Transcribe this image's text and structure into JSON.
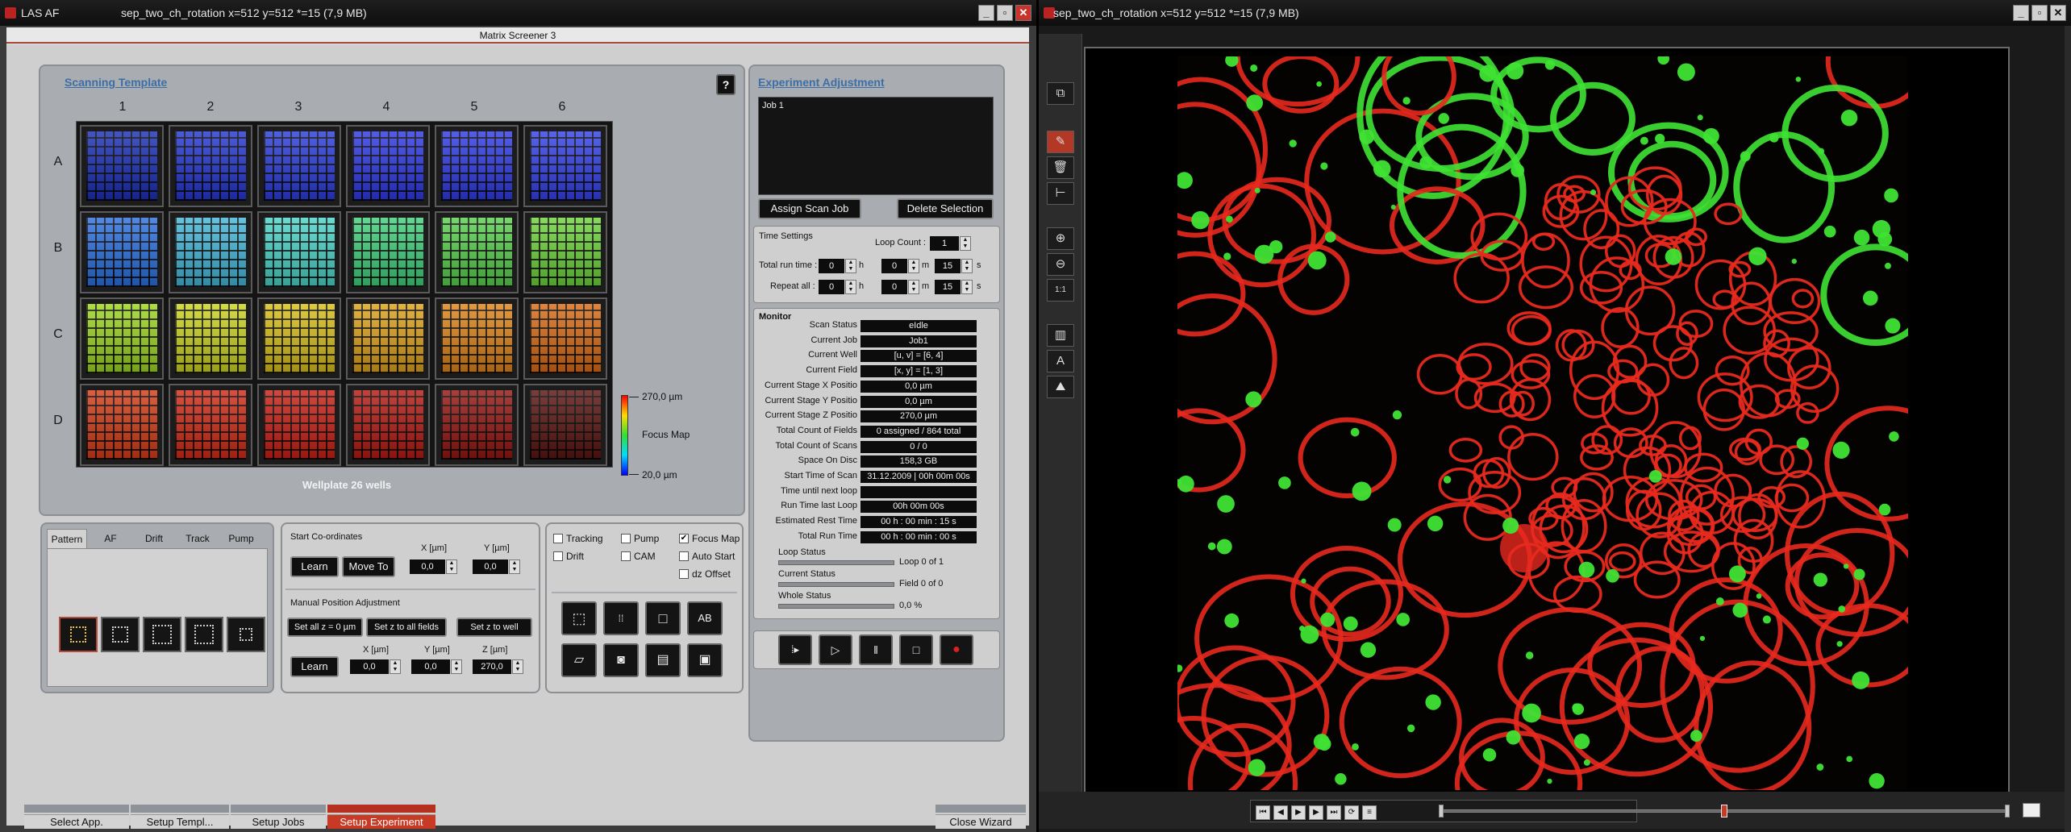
{
  "left_window": {
    "title": "LAS AF",
    "subtitle": "sep_two_ch_rotation x=512 y=512 *=15 (7,9 MB)",
    "app_title": "Matrix Screener 3"
  },
  "right_window": {
    "title": "sep_two_ch_rotation x=512 y=512 *=15 (7,9 MB)"
  },
  "window_buttons": {
    "minimize": "_",
    "restore": "▫",
    "close": "✕"
  },
  "scanning_template": {
    "title": "Scanning Template",
    "help": "?",
    "columns": [
      "1",
      "2",
      "3",
      "4",
      "5",
      "6"
    ],
    "rows": [
      "A",
      "B",
      "C",
      "D"
    ],
    "well_colors": [
      [
        "#1a2fb8",
        "#2436d2",
        "#2a3cdc",
        "#2d38e6",
        "#2f3ae6",
        "#3341ea"
      ],
      [
        "#2b6fe0",
        "#43b6d8",
        "#4ad4c8",
        "#3fd07a",
        "#58cf4d",
        "#6dd23b"
      ],
      [
        "#9cd520",
        "#cbd31f",
        "#d8be1a",
        "#dca11a",
        "#dd8318",
        "#d86a15"
      ],
      [
        "#d43b17",
        "#d12a16",
        "#c91f14",
        "#b51912",
        "#951511",
        "#5a1410"
      ]
    ],
    "plate_label": "Wellplate 26 wells",
    "colorbar": {
      "max": "270,0 µm",
      "label": "Focus Map",
      "min": "20,0 µm"
    }
  },
  "pattern_panel": {
    "tabs": [
      "Pattern",
      "AF",
      "Drift",
      "Track",
      "Pump"
    ]
  },
  "start_coords": {
    "title": "Start Co-ordinates",
    "x_label": "X [µm]",
    "y_label": "Y [µm]",
    "learn": "Learn",
    "move_to": "Move To",
    "x_value": "0,0",
    "y_value": "0,0"
  },
  "manual_pos": {
    "title": "Manual Position Adjustment",
    "set_all": "Set all  z = 0 µm",
    "set_fields": "Set z to all fields",
    "set_well": "Set z to well",
    "learn": "Learn",
    "x_label": "X [µm]",
    "y_label": "Y [µm]",
    "z_label": "Z [µm]",
    "x_value": "0,0",
    "y_value": "0,0",
    "z_value": "270,0"
  },
  "options": {
    "tracking": "Tracking",
    "pump": "Pump",
    "focus_map": "Focus Map",
    "drift": "Drift",
    "cam": "CAM",
    "auto_start": "Auto Start",
    "dz_offset": "dz Offset"
  },
  "experiment": {
    "title": "Experiment Adjustment",
    "job": "Job 1",
    "assign": "Assign Scan Job",
    "delete": "Delete Selection"
  },
  "time_settings": {
    "title": "Time Settings",
    "loop_count_label": "Loop Count :",
    "loop_count": "1",
    "total_label": "Total run time :",
    "repeat_label": "Repeat all :",
    "total_h": "0",
    "total_m": "0",
    "total_s": "15",
    "repeat_h": "0",
    "repeat_m": "0",
    "repeat_s": "15",
    "h": "h",
    "m": "m",
    "s": "s"
  },
  "monitor": {
    "title": "Monitor",
    "rows": [
      {
        "label": "Scan Status",
        "value": "eIdle"
      },
      {
        "label": "Current Job",
        "value": "Job1"
      },
      {
        "label": "Current Well",
        "value": "[u, v] = [6, 4]"
      },
      {
        "label": "Current Field",
        "value": "[x, y] = [1, 3]"
      },
      {
        "label": "Current Stage X Positio",
        "value": "0,0 µm"
      },
      {
        "label": "Current Stage Y Positio",
        "value": "0,0 µm"
      },
      {
        "label": "Current Stage Z Positio",
        "value": "270,0 µm"
      },
      {
        "label": "Total Count of Fields",
        "value": "0 assigned / 864 total"
      },
      {
        "label": "Total Count of Scans",
        "value": "0 / 0"
      },
      {
        "label": "Space On Disc",
        "value": "158,3 GB"
      },
      {
        "label": "Start Time of Scan",
        "value": "31.12.2009 | 00h 00m 00s"
      },
      {
        "label": "Time until next loop",
        "value": ""
      },
      {
        "label": "Run Time last Loop",
        "value": "00h 00m 00s"
      },
      {
        "label": "Estimated Rest Time",
        "value": "00 h : 00 min : 15 s"
      },
      {
        "label": "Total Run Time",
        "value": "00 h : 00 min : 00 s"
      }
    ],
    "loop_status_label": "Loop Status",
    "loop_status": "Loop 0 of 1",
    "current_status_label": "Current Status",
    "current_status": "Field 0 of 0",
    "whole_status_label": "Whole Status",
    "whole_status": "0,0 %"
  },
  "wizard": {
    "steps": [
      "Select App.",
      "Setup Templ...",
      "Setup Jobs",
      "Setup Experiment"
    ],
    "active": 3,
    "close": "Close Wizard"
  },
  "viewer": {
    "tools": [
      "overlay-icon",
      "pencil-icon",
      "trash-icon",
      "measure-icon",
      "zoom-in-icon",
      "zoom-out-icon",
      "fit-1to1-icon",
      "lut-icon",
      "text-icon",
      "histogram-icon"
    ],
    "slider_value": 0.5,
    "channel_colors": {
      "red": "#e8291e",
      "green": "#3fe334"
    }
  }
}
